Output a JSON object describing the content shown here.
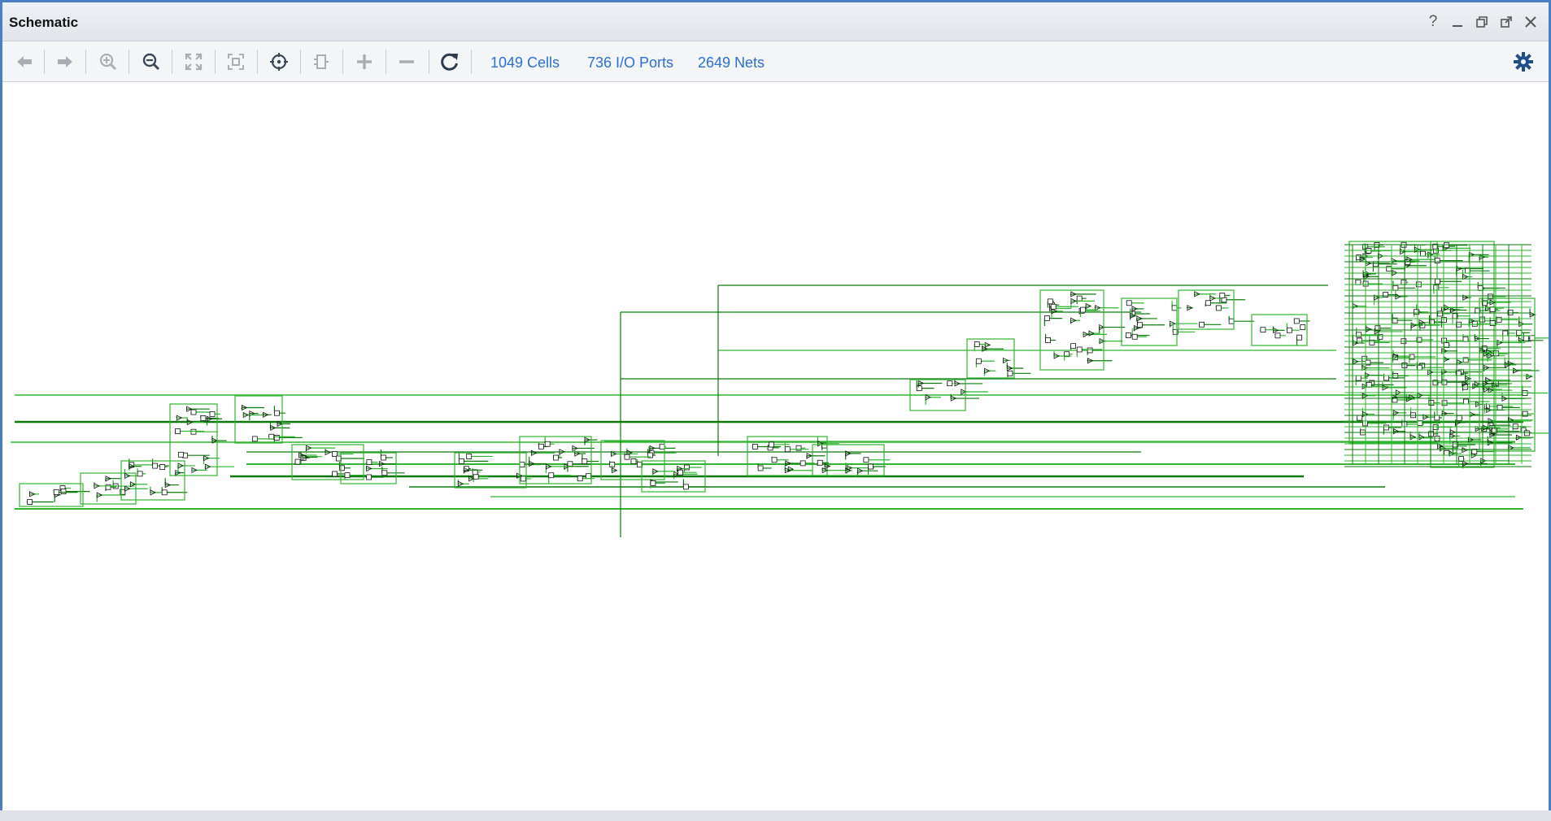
{
  "window": {
    "title": "Schematic"
  },
  "window_controls": [
    {
      "name": "help-icon",
      "glyph": "?"
    },
    {
      "name": "minimize-icon",
      "glyph": "_"
    },
    {
      "name": "restore-icon",
      "glyph": "restore"
    },
    {
      "name": "float-icon",
      "glyph": "float"
    },
    {
      "name": "close-icon",
      "glyph": "×"
    }
  ],
  "toolbar": {
    "buttons": [
      {
        "name": "back-button",
        "icon": "arrow-left-icon",
        "enabled": false
      },
      {
        "name": "forward-button",
        "icon": "arrow-right-icon",
        "enabled": false
      },
      {
        "name": "zoom-in-button",
        "icon": "zoom-in-icon",
        "enabled": false
      },
      {
        "name": "zoom-out-button",
        "icon": "zoom-out-icon",
        "enabled": true
      },
      {
        "name": "zoom-fit-button",
        "icon": "expand-icon",
        "enabled": false
      },
      {
        "name": "zoom-selection-button",
        "icon": "fit-selection-icon",
        "enabled": false
      },
      {
        "name": "auto-fit-selection-button",
        "icon": "crosshair-icon",
        "enabled": true
      },
      {
        "name": "show-cell-button",
        "icon": "cell-icon",
        "enabled": false
      },
      {
        "name": "expand-button",
        "icon": "plus-icon",
        "enabled": false
      },
      {
        "name": "collapse-button",
        "icon": "minus-icon",
        "enabled": false
      },
      {
        "name": "regenerate-button",
        "icon": "refresh-icon",
        "enabled": true
      }
    ],
    "stats": {
      "cells": "1049 Cells",
      "ports": "736 I/O Ports",
      "nets": "2649 Nets"
    },
    "settings_icon": "gear-icon"
  },
  "colors": {
    "accent": "#2a6fd3",
    "window_border": "#4a7fc4",
    "net_dark": "#0b7a0b",
    "net_light": "#2fb52f",
    "disabled_icon": "#a9adb3",
    "enabled_icon": "#3a4656",
    "settings": "#1f4f86"
  }
}
